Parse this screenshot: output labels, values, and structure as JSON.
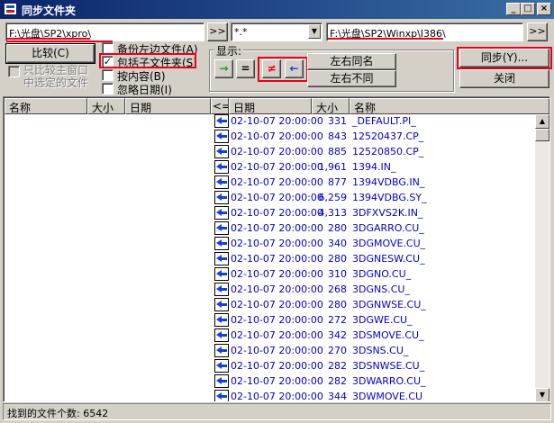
{
  "window": {
    "title": "同步文件夹",
    "minimize": "_",
    "maximize": "□",
    "close": "×"
  },
  "left_path": "F:\\光盘\\SP2\\xpro\\",
  "browse_left": ">>",
  "filter_value": "*.*",
  "right_path": "F:\\光盘\\SP2\\Winxp\\I386\\",
  "browse_right": ">>",
  "compare_button": "比较(C)",
  "only_selected": "只比较主窗口\n中选定的文件",
  "options": {
    "backup": "备份左边文件(A)",
    "include_subfolders": "包括子文件夹(S)",
    "by_content": "按内容(B)",
    "ignore_date": "忽略日期(I)"
  },
  "display": {
    "label": "显示:",
    "right_arrow": "→",
    "equal": "=",
    "not_equal": "≠",
    "left_arrow": "←",
    "same_name": "左右同名",
    "different": "左右不同"
  },
  "sync_button": "同步(Y)...",
  "close_button": "关闭",
  "columns": {
    "left_name": "名称",
    "left_size": "大小",
    "left_date": "日期",
    "direction": "<=>",
    "right_date": "日期",
    "right_size": "大小",
    "right_name": "名称"
  },
  "rows": [
    {
      "date": "02-10-07 20:00:00",
      "size": "331",
      "name": "_DEFAULT.PI_"
    },
    {
      "date": "02-10-07 20:00:00",
      "size": "843",
      "name": "12520437.CP_"
    },
    {
      "date": "02-10-07 20:00:00",
      "size": "885",
      "name": "12520850.CP_"
    },
    {
      "date": "02-10-07 20:00:00",
      "size": "1,961",
      "name": "1394.IN_"
    },
    {
      "date": "02-10-07 20:00:00",
      "size": "877",
      "name": "1394VDBG.IN_"
    },
    {
      "date": "02-10-07 20:00:00",
      "size": "6,259",
      "name": "1394VDBG.SY_"
    },
    {
      "date": "02-10-07 20:00:00",
      "size": "4,313",
      "name": "3DFXVS2K.IN_"
    },
    {
      "date": "02-10-07 20:00:00",
      "size": "280",
      "name": "3DGARRO.CU_"
    },
    {
      "date": "02-10-07 20:00:00",
      "size": "340",
      "name": "3DGMOVE.CU_"
    },
    {
      "date": "02-10-07 20:00:00",
      "size": "280",
      "name": "3DGNESW.CU_"
    },
    {
      "date": "02-10-07 20:00:00",
      "size": "310",
      "name": "3DGNO.CU_"
    },
    {
      "date": "02-10-07 20:00:00",
      "size": "268",
      "name": "3DGNS.CU_"
    },
    {
      "date": "02-10-07 20:00:00",
      "size": "280",
      "name": "3DGNWSE.CU_"
    },
    {
      "date": "02-10-07 20:00:00",
      "size": "272",
      "name": "3DGWE.CU_"
    },
    {
      "date": "02-10-07 20:00:00",
      "size": "342",
      "name": "3DSMOVE.CU_"
    },
    {
      "date": "02-10-07 20:00:00",
      "size": "270",
      "name": "3DSNS.CU_"
    },
    {
      "date": "02-10-07 20:00:00",
      "size": "282",
      "name": "3DSNWSE.CU_"
    },
    {
      "date": "02-10-07 20:00:00",
      "size": "282",
      "name": "3DWARRO.CU_"
    },
    {
      "date": "02-10-07 20:00:00",
      "size": "344",
      "name": "3DWMOVE.CU"
    }
  ],
  "status": "找到的文件个数: 6542",
  "colors": {
    "highlight": "#e8001c",
    "titlebar": "#0a246a",
    "file_text": "#0000c8"
  }
}
